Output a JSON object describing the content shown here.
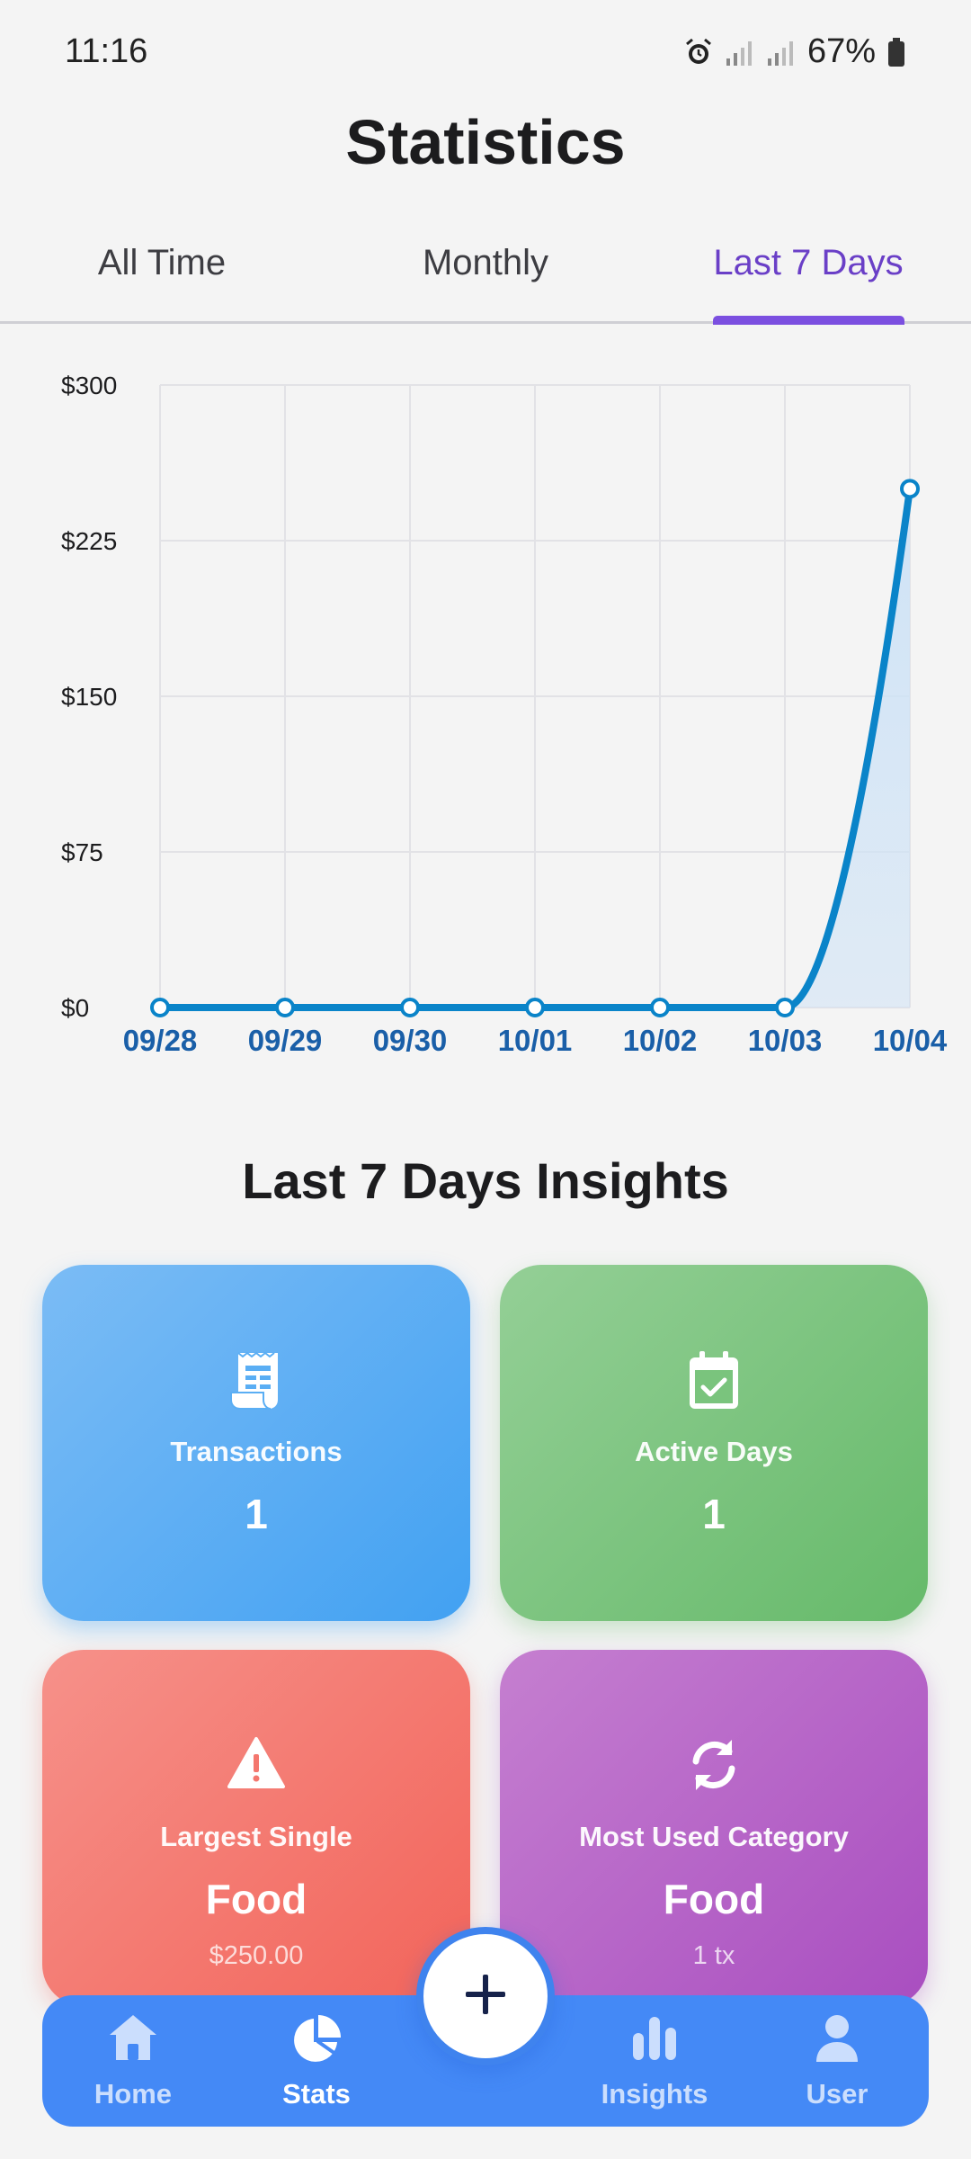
{
  "status_bar": {
    "time": "11:16",
    "battery": "67%"
  },
  "page": {
    "title": "Statistics"
  },
  "tabs": [
    {
      "label": "All Time",
      "active": false
    },
    {
      "label": "Monthly",
      "active": false
    },
    {
      "label": "Last 7 Days",
      "active": true
    }
  ],
  "chart_data": {
    "type": "area",
    "x": [
      "09/28",
      "09/29",
      "09/30",
      "10/01",
      "10/02",
      "10/03",
      "10/04"
    ],
    "series": [
      {
        "values": [
          0,
          0,
          0,
          0,
          0,
          0,
          250
        ]
      }
    ],
    "y_ticks": [
      "$0",
      "$75",
      "$150",
      "$225",
      "$300"
    ],
    "ylim": [
      0,
      300
    ],
    "grid": true,
    "colors": {
      "line": "#0a84c9",
      "fill": "#cfe3f6",
      "x_tick": "#1a5fa8"
    }
  },
  "insights": {
    "title": "Last 7 Days Insights",
    "cards": {
      "transactions": {
        "label": "Transactions",
        "value": "1",
        "icon": "receipt-icon"
      },
      "active_days": {
        "label": "Active Days",
        "value": "1",
        "icon": "calendar-check-icon"
      },
      "largest_single": {
        "label": "Largest Single",
        "value": "Food",
        "sub": "$250.00",
        "icon": "warning-icon"
      },
      "most_used_category": {
        "label": "Most Used Category",
        "value": "Food",
        "sub": "1 tx",
        "icon": "refresh-icon"
      }
    }
  },
  "bottom_nav": {
    "items": [
      {
        "label": "Home",
        "icon": "home-icon",
        "active": false
      },
      {
        "label": "Stats",
        "icon": "pie-chart-icon",
        "active": true
      },
      {
        "label": "Insights",
        "icon": "bar-chart-icon",
        "active": false
      },
      {
        "label": "User",
        "icon": "user-icon",
        "active": false
      }
    ],
    "fab_icon": "plus-icon"
  },
  "colors": {
    "accent": "#7b4fe0",
    "nav_bg": "#4489f6",
    "card_blue": "#42a1f2",
    "card_green": "#66ba6a",
    "card_red": "#f2645a",
    "card_purple": "#a94ec0"
  }
}
